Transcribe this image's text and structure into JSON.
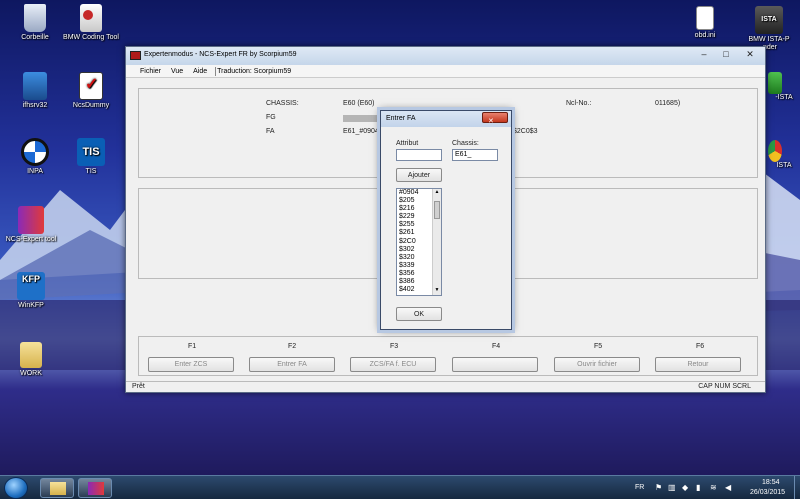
{
  "desktop": {
    "icons": [
      {
        "label": "Corbeille",
        "icon": "recycle-bin-icon"
      },
      {
        "label": "BMW Coding Tool",
        "icon": "bmw-coding-tool-icon"
      },
      {
        "label": "ifhsrv32",
        "icon": "network-icon"
      },
      {
        "label": "NcsDummy",
        "icon": "ncsdummy-icon"
      },
      {
        "label": "INPA",
        "icon": "bmw-logo-icon"
      },
      {
        "label": "TIS",
        "icon": "tis-icon"
      },
      {
        "label": "NCS-Expert tool",
        "icon": "ncs-expert-icon"
      },
      {
        "label": "WinKFP",
        "icon": "kfp-icon"
      },
      {
        "label": "WORK",
        "icon": "folder-icon"
      },
      {
        "label": "obd.ini",
        "icon": "file-icon"
      },
      {
        "label": "BMW ISTA-P",
        "icon": "ista-icon"
      }
    ],
    "partial_labels": [
      "nder",
      "-ISTA",
      "ISTA"
    ]
  },
  "main_window": {
    "title": "Expertenmodus - NCS-Expert FR by Scorpium59",
    "menu": [
      "Fichier",
      "Vue",
      "Aide",
      "Traduction: Scorpium59"
    ],
    "info": {
      "chassis_label": "CHASSIS:",
      "chassis_value": "E60 (E60)",
      "fg_label": "FG",
      "fa_label": "FA",
      "fa_value": "E61_#0904",
      "fa_value_tail": "$2C0$3",
      "nrcl_label": "Ncl-No.:",
      "nrcl_value": "011685)"
    },
    "function_keys": [
      {
        "key": "F1",
        "label": "Enter ZCS"
      },
      {
        "key": "F2",
        "label": "Entrer FA"
      },
      {
        "key": "F3",
        "label": "ZCS/FA f. ECU"
      },
      {
        "key": "F4",
        "label": ""
      },
      {
        "key": "F5",
        "label": "Ouvrir fichier"
      },
      {
        "key": "F6",
        "label": "Retour"
      }
    ],
    "status": {
      "left": "Prêt",
      "right": "CAP NUM SCRL"
    }
  },
  "dialog": {
    "title": "Entrer FA",
    "attribut_label": "Attribut",
    "attribut_value": "",
    "chassis_label": "Chassis:",
    "chassis_value": "E61_",
    "add_button": "Ajouter",
    "list_items": [
      "#0904",
      "$205",
      "$216",
      "$229",
      "$255",
      "$261",
      "$2C0",
      "$302",
      "$320",
      "$339",
      "$356",
      "$386",
      "$402"
    ],
    "ok_button": "OK"
  },
  "taskbar": {
    "lang": "FR",
    "time": "18:54",
    "date": "26/03/2015"
  },
  "colors": {
    "accent": "#3a5bc2",
    "close_red": "#c4381f",
    "window_bg": "#f0f0f0"
  }
}
